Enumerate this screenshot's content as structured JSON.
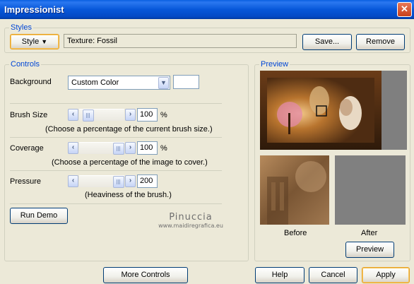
{
  "window": {
    "title": "Impressionist",
    "close_glyph": "✕"
  },
  "styles": {
    "legend": "Styles",
    "style_button": "Style",
    "style_button_glyph": "▼",
    "texture": "Texture: Fossil",
    "save_button": "Save...",
    "remove_button": "Remove"
  },
  "controls": {
    "legend": "Controls",
    "background_label": "Background",
    "background_value": "Custom Color",
    "brush_size": {
      "label": "Brush Size",
      "value": "100",
      "unit": "%",
      "hint": "(Choose a percentage of the current brush size.)",
      "level": 0.1
    },
    "coverage": {
      "label": "Coverage",
      "value": "100",
      "unit": "%",
      "hint": "(Choose a percentage of the image to cover.)",
      "level": 1.0
    },
    "pressure": {
      "label": "Pressure",
      "value": "200",
      "hint": "(Heaviness of the brush.)",
      "level": 1.0
    },
    "run_demo_button": "Run Demo"
  },
  "watermark": {
    "name": "Pinuccia",
    "url": "www.maidiregrafica.eu"
  },
  "preview": {
    "legend": "Preview",
    "before_label": "Before",
    "after_label": "After",
    "preview_button": "Preview"
  },
  "footer": {
    "more_controls_button": "More Controls",
    "help_button": "Help",
    "cancel_button": "Cancel",
    "apply_button": "Apply"
  },
  "colors": {
    "titlebar": "#0757d9",
    "legend": "#0046d5",
    "dialog_bg": "#ece9d8",
    "after_preview": "#808080"
  }
}
